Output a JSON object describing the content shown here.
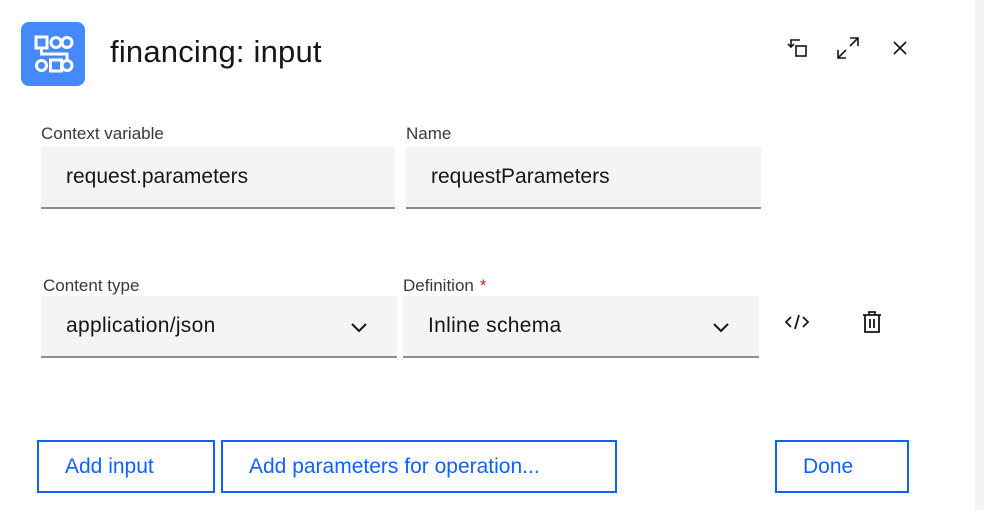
{
  "header": {
    "title": "financing: input",
    "icons": [
      "flow-diagram-icon",
      "restore-icon",
      "maximize-icon",
      "close-icon"
    ]
  },
  "form": {
    "context_variable": {
      "label": "Context variable",
      "value": "request.parameters"
    },
    "name": {
      "label": "Name",
      "value": "requestParameters"
    },
    "content_type": {
      "label": "Content type",
      "value": "application/json"
    },
    "definition": {
      "label": "Definition",
      "required_mark": "*",
      "value": "Inline schema"
    }
  },
  "row_icons": [
    "code-icon",
    "trash-icon"
  ],
  "buttons": {
    "add_input": "Add input",
    "add_parameters": "Add parameters for operation...",
    "done": "Done"
  },
  "colors": {
    "accent": "#0f62fe",
    "app_icon_bg": "#4589ff",
    "field_bg": "#f4f4f4",
    "required": "#da1e28"
  }
}
